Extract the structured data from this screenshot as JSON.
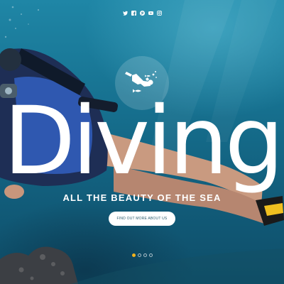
{
  "social": [
    {
      "icon": "twitter-icon"
    },
    {
      "icon": "facebook-icon"
    },
    {
      "icon": "pinterest-icon"
    },
    {
      "icon": "youtube-icon"
    },
    {
      "icon": "instagram-icon"
    }
  ],
  "hero": {
    "badge_icon": "scuba-diver-icon",
    "title": "Diving",
    "subtitle": "ALL THE BEAUTY OF THE SEA",
    "cta_label": "FIND OUT MORE ABOUT US"
  },
  "slider": {
    "total_slides": 4,
    "active_slide": 1
  },
  "colors": {
    "water_top": "#1f86a6",
    "water_bottom": "#0e4d68",
    "title": "#ffffff",
    "button_bg": "#ffffff",
    "button_text": "#2b5b6d",
    "active_dot": "#f2b21c"
  }
}
